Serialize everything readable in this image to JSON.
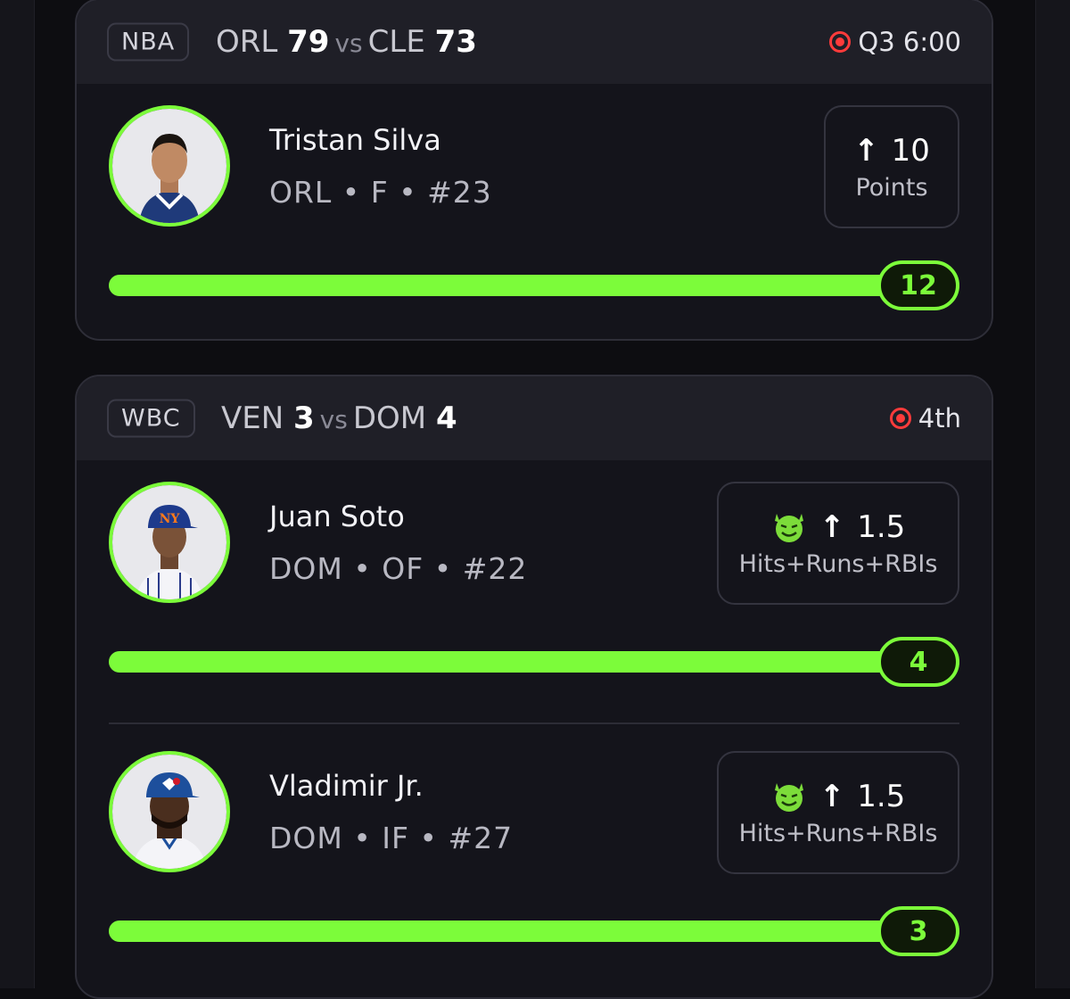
{
  "cards": [
    {
      "league": "NBA",
      "team1": "ORL",
      "score1": "79",
      "vs": "vs",
      "team2": "CLE",
      "score2": "73",
      "status": "Q3 6:00",
      "players": [
        {
          "name": "Tristan Silva",
          "info": "ORL • F • #23",
          "line": "10",
          "stat": "Points",
          "current": "12",
          "progress": 1.0,
          "demon": false
        }
      ]
    },
    {
      "league": "WBC",
      "team1": "VEN",
      "score1": "3",
      "vs": "vs",
      "team2": "DOM",
      "score2": "4",
      "status": "4th",
      "players": [
        {
          "name": "Juan Soto",
          "info": "DOM • OF • #22",
          "line": "1.5",
          "stat": "Hits+Runs+RBIs",
          "current": "4",
          "progress": 1.0,
          "demon": true
        },
        {
          "name": "Vladimir Jr.",
          "info": "DOM • IF • #27",
          "line": "1.5",
          "stat": "Hits+Runs+RBIs",
          "current": "3",
          "progress": 1.0,
          "demon": true
        }
      ]
    }
  ],
  "colors": {
    "accent": "#7cfc3a",
    "live": "#ff3b3b",
    "background": "#0d0d11"
  },
  "icons": {
    "live": "live-indicator-icon",
    "arrow": "arrow-up-icon",
    "demon": "demon-icon"
  }
}
